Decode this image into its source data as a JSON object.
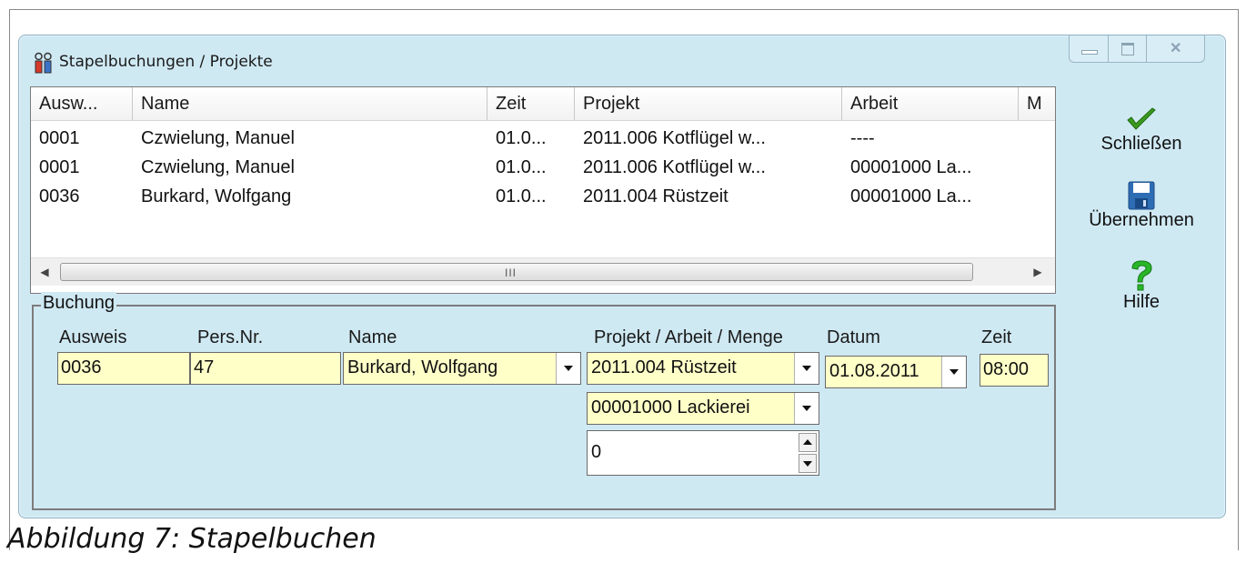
{
  "window": {
    "title": "Stapelbuchungen / Projekte"
  },
  "list": {
    "columns": [
      "Ausw...",
      "Name",
      "Zeit",
      "Projekt",
      "Arbeit",
      "M"
    ],
    "rows": [
      [
        "0001",
        "Czwielung, Manuel",
        "01.0...",
        "2011.006 Kotflügel w...",
        "----"
      ],
      [
        "0001",
        "Czwielung, Manuel",
        "01.0...",
        "2011.006 Kotflügel w...",
        "00001000 La..."
      ],
      [
        "0036",
        "Burkard, Wolfgang",
        "01.0...",
        "2011.004 Rüstzeit",
        "00001000 La..."
      ]
    ],
    "scroll_grip": "III"
  },
  "buchung": {
    "group_title": "Buchung",
    "labels": {
      "ausweis": "Ausweis",
      "persnr": "Pers.Nr.",
      "name": "Name",
      "projekt": "Projekt / Arbeit / Menge",
      "datum": "Datum",
      "zeit": "Zeit"
    },
    "values": {
      "ausweis": "0036",
      "persnr": "47",
      "name": "Burkard, Wolfgang",
      "projekt": "2011.004 Rüstzeit",
      "arbeit": "00001000 Lackierei",
      "menge": "0",
      "datum": "01.08.2011",
      "zeit": "08:00"
    }
  },
  "actions": {
    "close": "Schließen",
    "apply": "Übernehmen",
    "help": "Hilfe"
  },
  "colors": {
    "window_bg": "#cfe9f3",
    "field_bg": "#ffffc8",
    "check_green": "#3a9a1e",
    "save_blue": "#2e6db4",
    "help_green": "#29b629"
  },
  "caption": "Abbildung 7: Stapelbuchen"
}
